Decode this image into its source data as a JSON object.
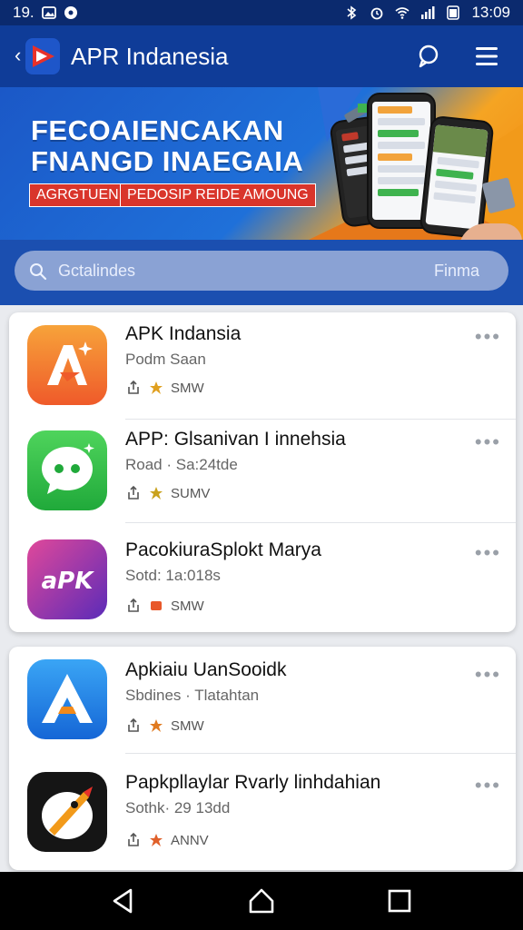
{
  "status_bar": {
    "time_left": "19.",
    "time_right": "13:09",
    "icons": [
      "gallery-icon",
      "notification-dot-icon",
      "bluetooth-icon",
      "alarm-icon",
      "wifi-icon",
      "signal-icon",
      "battery-icon"
    ]
  },
  "app_bar": {
    "title": "APR Indanesia",
    "icons": [
      "back-chevron-icon",
      "app-logo",
      "chat-icon",
      "menu-icon"
    ]
  },
  "banner": {
    "headline_1": "FECOAIENCAKAN",
    "headline_2": "FNANGD INAEGAIA",
    "tag_1": "AGRGTUENI",
    "tag_2": "PEDOSIP REIDE AMOUNG"
  },
  "search": {
    "placeholder": "Gctalindes",
    "action": "Finma"
  },
  "apps": [
    {
      "name": "APK Indansia",
      "subtitle": "Podm Saan",
      "meta": "SMW",
      "icon": "apk-logo-icon",
      "color_top": "#f7a33a",
      "color_bottom": "#ef5a2a"
    },
    {
      "name": "APP: Glsanivan I innehsia",
      "subtitle": "Road · Sa:24tde",
      "meta": "SUMV",
      "icon": "chat-bubble-icon",
      "color_top": "#4fd45c",
      "color_bottom": "#20a93a"
    },
    {
      "name": "PacokiuraSplokt Marya",
      "subtitle": "Sotd: 1a:018s",
      "meta": "SMW",
      "icon": "apk-text-icon",
      "color_top": "#d8439d",
      "color_bottom": "#5b2bb8"
    },
    {
      "name": "Apkiaiu UanSooidk",
      "subtitle": "Sbdines · Tlatahtan",
      "meta": "SMW",
      "icon": "triangle-a-icon",
      "color_top": "#3aa5f5",
      "color_bottom": "#1566d6"
    },
    {
      "name": "Papkpllaylar Rvarly linhdahian",
      "subtitle": "Sothk· 29 13dd",
      "meta": "ANNV",
      "icon": "rocket-icon",
      "color_top": "#111111",
      "color_bottom": "#222222"
    }
  ],
  "nav_bar": {
    "icons": [
      "back-triangle-icon",
      "home-icon",
      "recents-icon"
    ]
  }
}
